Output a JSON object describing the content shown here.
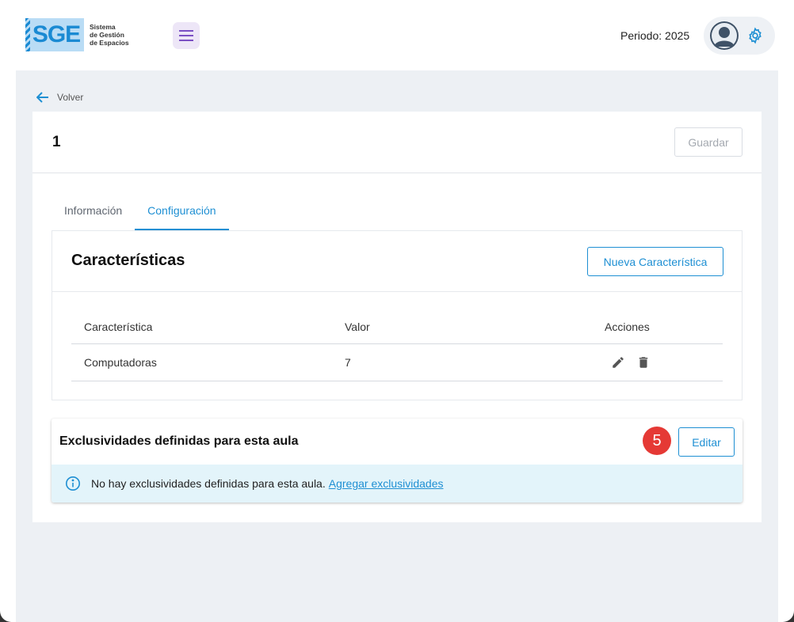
{
  "header": {
    "logo_text": "SGE",
    "logo_subtitle_1": "Sistema",
    "logo_subtitle_2": "de Gestión",
    "logo_subtitle_3": "de Espacios",
    "periodo": "Periodo: 2025",
    "menu_icon": "hamburger-icon",
    "settings_icon": "gear-icon"
  },
  "nav": {
    "back_label": "Volver"
  },
  "record": {
    "title": "1",
    "save_label": "Guardar"
  },
  "tabs": [
    {
      "label": "Información",
      "active": false
    },
    {
      "label": "Configuración",
      "active": true
    }
  ],
  "caracteristicas": {
    "title": "Características",
    "new_button": "Nueva Característica",
    "columns": [
      "Característica",
      "Valor",
      "Acciones"
    ],
    "rows": [
      {
        "caracteristica": "Computadoras",
        "valor": "7"
      }
    ]
  },
  "exclusividades": {
    "title": "Exclusividades definidas para esta aula",
    "badge": "5",
    "edit_button": "Editar",
    "info_text": "No hay exclusividades definidas para esta aula.",
    "info_link": "Agregar exclusividades"
  },
  "colors": {
    "primary": "#1e8fd3",
    "badge": "#e53935",
    "info_bg": "#e3f4fa",
    "page_bg": "#edf0f4"
  }
}
